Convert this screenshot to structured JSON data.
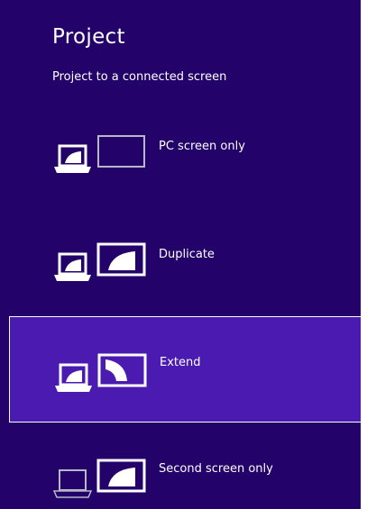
{
  "header": {
    "title": "Project",
    "subtitle": "Project to a connected screen"
  },
  "options": [
    {
      "label": "PC screen only",
      "selected": false
    },
    {
      "label": "Duplicate",
      "selected": false
    },
    {
      "label": "Extend",
      "selected": true
    },
    {
      "label": "Second screen only",
      "selected": false
    }
  ],
  "colors": {
    "background": "#23036a",
    "selected": "#4b1ab0",
    "foreground": "#ffffff",
    "inactive_outline": "#b8b8c8"
  }
}
